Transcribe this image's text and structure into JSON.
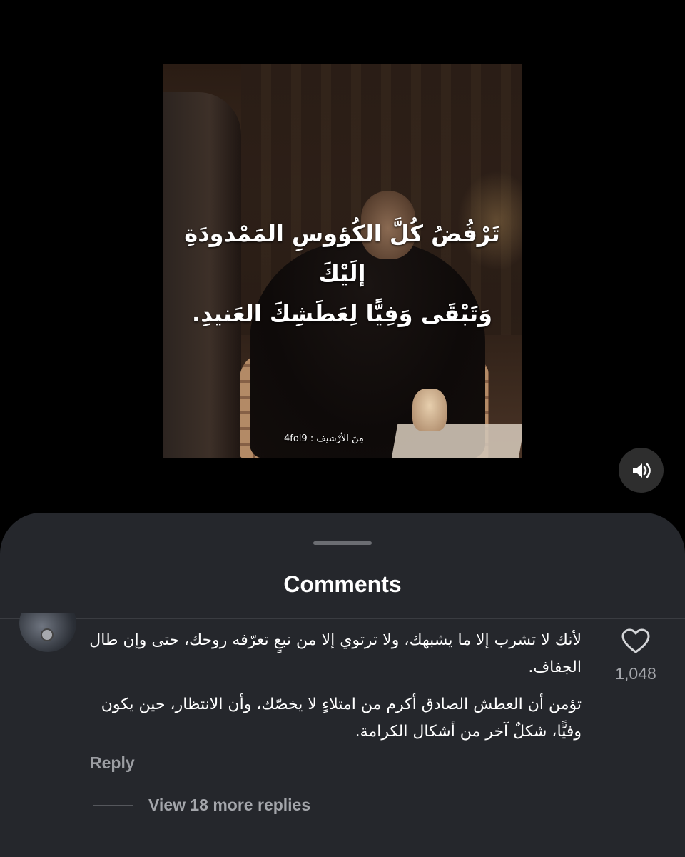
{
  "video": {
    "caption_lines": [
      "تَرْفُضُ كُلَّ الكُؤوسِ المَمْدودَةِ إلَيْكَ",
      "وَتَبْقَى وَفِيًّا لِعَطَشِكَ العَنيدِ."
    ],
    "watermark": "مِنَ الأرْشيف : 4fol9",
    "sound_icon": "speaker-on-icon"
  },
  "comments": {
    "title": "Comments",
    "items": [
      {
        "paragraphs": [
          "لأنك لا تشرب إلا ما يشبهك، ولا ترتوي إلا من نبعٍ تعرّفه روحك، حتى وإن طال الجفاف.",
          "تؤمن أن العطش الصادق أكرم من امتلاءٍ لا يخصّك، وأن الانتظار، حين يكون وفيًّا، شكلٌ آخر من أشكال الكرامة."
        ],
        "like_count": "1,048",
        "reply_label": "Reply",
        "view_more_label": "View 18 more replies"
      }
    ]
  },
  "colors": {
    "sheet_bg": "#25272c",
    "secondary_text": "#a4a6ab"
  }
}
